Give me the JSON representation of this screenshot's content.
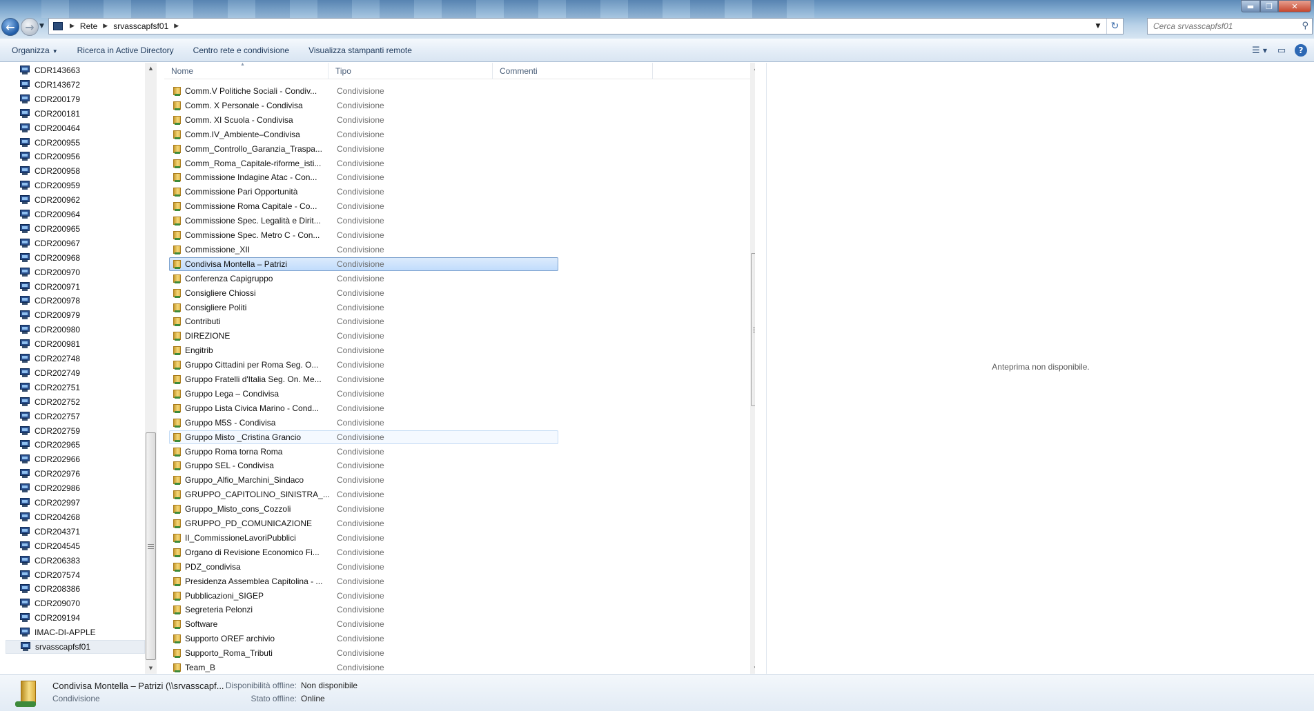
{
  "window": {
    "breadcrumb": [
      "Rete",
      "srvasscapfsf01"
    ],
    "search_placeholder": "Cerca srvasscapfsf01"
  },
  "toolbar": {
    "organize": "Organizza",
    "active_directory": "Ricerca in Active Directory",
    "network_center": "Centro rete e condivisione",
    "remote_printers": "Visualizza stampanti remote"
  },
  "nav": {
    "items": [
      "CDR143663",
      "CDR143672",
      "CDR200179",
      "CDR200181",
      "CDR200464",
      "CDR200955",
      "CDR200956",
      "CDR200958",
      "CDR200959",
      "CDR200962",
      "CDR200964",
      "CDR200965",
      "CDR200967",
      "CDR200968",
      "CDR200970",
      "CDR200971",
      "CDR200978",
      "CDR200979",
      "CDR200980",
      "CDR200981",
      "CDR202748",
      "CDR202749",
      "CDR202751",
      "CDR202752",
      "CDR202757",
      "CDR202759",
      "CDR202965",
      "CDR202966",
      "CDR202976",
      "CDR202986",
      "CDR202997",
      "CDR204268",
      "CDR204371",
      "CDR204545",
      "CDR206383",
      "CDR207574",
      "CDR208386",
      "CDR209070",
      "CDR209194",
      "IMAC-DI-APPLE",
      "srvasscapfsf01"
    ],
    "selected": "srvasscapfsf01"
  },
  "columns": {
    "name": "Nome",
    "type": "Tipo",
    "comments": "Commenti"
  },
  "files": [
    {
      "name": "Comm.V Politiche Sociali - Condiv...",
      "type": "Condivisione"
    },
    {
      "name": "Comm. X Personale - Condivisa",
      "type": "Condivisione"
    },
    {
      "name": "Comm. XI Scuola - Condivisa",
      "type": "Condivisione"
    },
    {
      "name": "Comm.IV_Ambiente–Condivisa",
      "type": "Condivisione"
    },
    {
      "name": "Comm_Controllo_Garanzia_Traspa...",
      "type": "Condivisione"
    },
    {
      "name": "Comm_Roma_Capitale-riforme_isti...",
      "type": "Condivisione"
    },
    {
      "name": "Commissione Indagine Atac - Con...",
      "type": "Condivisione"
    },
    {
      "name": "Commissione Pari Opportunità",
      "type": "Condivisione"
    },
    {
      "name": "Commissione Roma Capitale - Co...",
      "type": "Condivisione"
    },
    {
      "name": "Commissione Spec. Legalità e Dirit...",
      "type": "Condivisione"
    },
    {
      "name": "Commissione Spec. Metro C - Con...",
      "type": "Condivisione"
    },
    {
      "name": "Commissione_XII",
      "type": "Condivisione"
    },
    {
      "name": "Condivisa Montella – Patrizi",
      "type": "Condivisione"
    },
    {
      "name": "Conferenza Capigruppo",
      "type": "Condivisione"
    },
    {
      "name": "Consigliere Chiossi",
      "type": "Condivisione"
    },
    {
      "name": "Consigliere Politi",
      "type": "Condivisione"
    },
    {
      "name": "Contributi",
      "type": "Condivisione"
    },
    {
      "name": "DIREZIONE",
      "type": "Condivisione"
    },
    {
      "name": "Engitrib",
      "type": "Condivisione"
    },
    {
      "name": "Gruppo Cittadini per Roma Seg. O...",
      "type": "Condivisione"
    },
    {
      "name": "Gruppo Fratelli d'Italia Seg. On. Me...",
      "type": "Condivisione"
    },
    {
      "name": "Gruppo Lega – Condivisa",
      "type": "Condivisione"
    },
    {
      "name": "Gruppo Lista Civica Marino - Cond...",
      "type": "Condivisione"
    },
    {
      "name": "Gruppo M5S - Condivisa",
      "type": "Condivisione"
    },
    {
      "name": "Gruppo Misto _Cristina Grancio",
      "type": "Condivisione"
    },
    {
      "name": "Gruppo Roma torna Roma",
      "type": "Condivisione"
    },
    {
      "name": "Gruppo SEL - Condivisa",
      "type": "Condivisione"
    },
    {
      "name": "Gruppo_Alfio_Marchini_Sindaco",
      "type": "Condivisione"
    },
    {
      "name": "GRUPPO_CAPITOLINO_SINISTRA_...",
      "type": "Condivisione"
    },
    {
      "name": "Gruppo_Misto_cons_Cozzoli",
      "type": "Condivisione"
    },
    {
      "name": "GRUPPO_PD_COMUNICAZIONE",
      "type": "Condivisione"
    },
    {
      "name": "II_CommissioneLavoriPubblici",
      "type": "Condivisione"
    },
    {
      "name": "Organo di Revisione Economico Fi...",
      "type": "Condivisione"
    },
    {
      "name": "PDZ_condivisa",
      "type": "Condivisione"
    },
    {
      "name": "Presidenza Assemblea Capitolina - ...",
      "type": "Condivisione"
    },
    {
      "name": "Pubblicazioni_SIGEP",
      "type": "Condivisione"
    },
    {
      "name": "Segreteria Pelonzi",
      "type": "Condivisione"
    },
    {
      "name": "Software",
      "type": "Condivisione"
    },
    {
      "name": "Supporto OREF archivio",
      "type": "Condivisione"
    },
    {
      "name": "Supporto_Roma_Tributi",
      "type": "Condivisione"
    },
    {
      "name": "Team_B",
      "type": "Condivisione"
    }
  ],
  "selected_file": "Condivisa Montella – Patrizi",
  "hover_file": "Gruppo Misto _Cristina Grancio",
  "preview": {
    "message": "Anteprima non disponibile."
  },
  "details": {
    "title": "Condivisa Montella – Patrizi (\\\\srvasscapf...",
    "type": "Condivisione",
    "offline_label": "Disponibilità offline:",
    "offline_value": "Non disponibile",
    "status_label": "Stato offline:",
    "status_value": "Online"
  }
}
